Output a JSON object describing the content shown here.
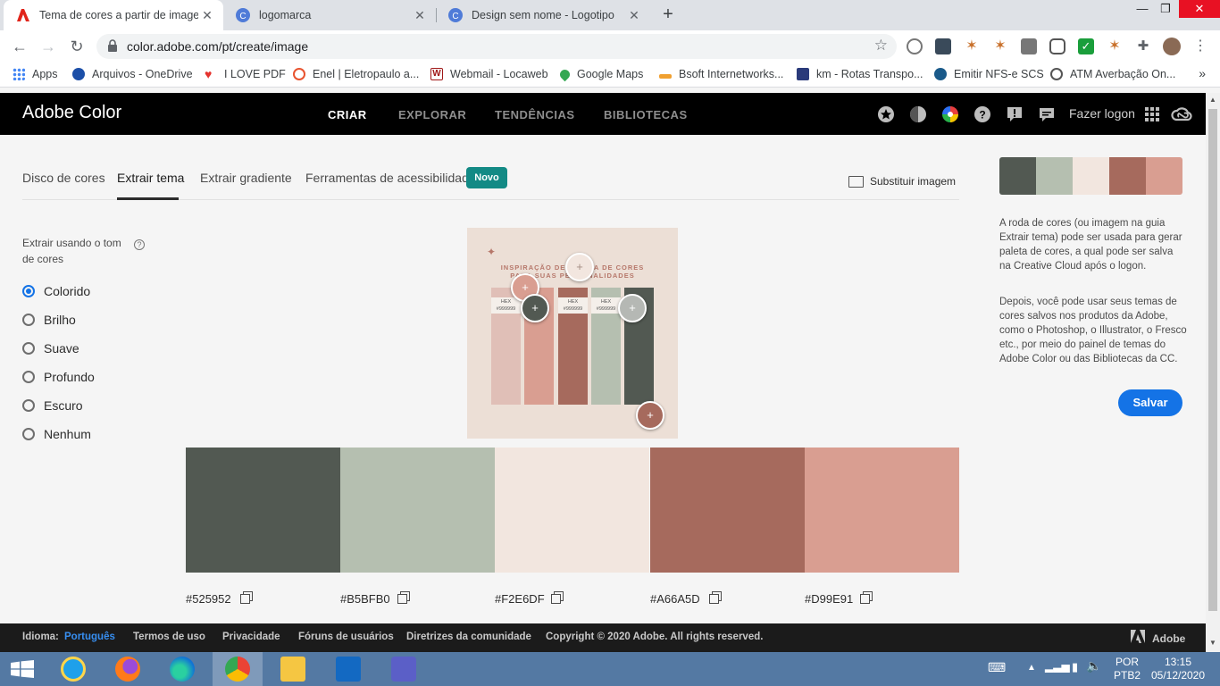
{
  "browser": {
    "tabs": [
      {
        "title": "Tema de cores a partir de imagem",
        "icon": "adobe-icon"
      },
      {
        "title": "logomarca",
        "icon": "canva-icon"
      },
      {
        "title": "Design sem nome - Logotipo",
        "icon": "canva-icon"
      }
    ],
    "url": "color.adobe.com/pt/create/image",
    "bookmarks": [
      {
        "label": "Apps"
      },
      {
        "label": "Arquivos - OneDrive"
      },
      {
        "label": "I LOVE PDF"
      },
      {
        "label": "Enel | Eletropaulo a..."
      },
      {
        "label": "Webmail - Locaweb"
      },
      {
        "label": "Google Maps"
      },
      {
        "label": "Bsoft Internetworks..."
      },
      {
        "label": "km - Rotas Transpo..."
      },
      {
        "label": "Emitir NFS-e SCS"
      },
      {
        "label": "ATM Averbação On..."
      }
    ],
    "bookmarks_more": "»"
  },
  "header": {
    "logo": "Adobe Color",
    "nav": [
      "CRIAR",
      "EXPLORAR",
      "TENDÊNCIAS",
      "BIBLIOTECAS"
    ],
    "login": "Fazer logon"
  },
  "subnav": {
    "items": [
      "Disco de cores",
      "Extrair tema",
      "Extrair gradiente",
      "Ferramentas de acessibilidade"
    ],
    "badge": "Novo",
    "replace_image": "Substituir imagem"
  },
  "extract": {
    "label": "Extrair usando o tom de cores",
    "help": "?",
    "options": [
      "Colorido",
      "Brilho",
      "Suave",
      "Profundo",
      "Escuro",
      "Nenhum"
    ],
    "selected": "Colorido"
  },
  "preview": {
    "title_line1": "INSPIRAÇÃO DE PALETA DE CORES",
    "title_line2": "PARA SUAS PERSONALIDADES",
    "hex_label": "HEX",
    "hex_value": "#999999"
  },
  "swatches": [
    {
      "hex": "#525952",
      "color": "#525952"
    },
    {
      "hex": "#B5BFB0",
      "color": "#B5BFB0"
    },
    {
      "hex": "#F2E6DF",
      "color": "#F2E6DF"
    },
    {
      "hex": "#A66A5D",
      "color": "#A66A5D"
    },
    {
      "hex": "#D99E91",
      "color": "#D99E91"
    }
  ],
  "sidebar": {
    "paragraph1": "A roda de cores (ou imagem na guia Extrair tema) pode ser usada para gerar paleta de cores, a qual pode ser salva na Creative Cloud após o logon.",
    "paragraph2": "Depois, você pode usar seus temas de cores salvos nos produtos da Adobe, como o Photoshop, o Illustrator, o Fresco etc., por meio do painel de temas do Adobe Color ou das Bibliotecas da CC.",
    "save": "Salvar"
  },
  "footer": {
    "lang_label": "Idioma:",
    "lang_value": "Português",
    "links": [
      "Termos de uso",
      "Privacidade",
      "Fóruns de usuários",
      "Diretrizes da comunidade"
    ],
    "copyright": "Copyright © 2020 Adobe. All rights reserved.",
    "brand": "Adobe"
  },
  "taskbar": {
    "lang1": "POR",
    "lang2": "PTB2",
    "time": "13:15",
    "date": "05/12/2020"
  }
}
